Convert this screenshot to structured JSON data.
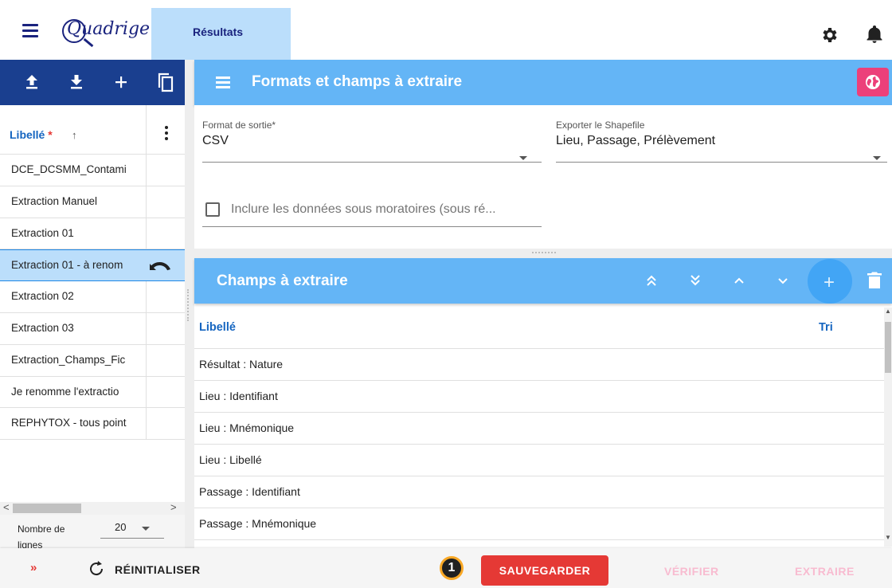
{
  "app": {
    "logo_text": "Quadrige"
  },
  "top_tabs": [
    {
      "label": "Résultats"
    }
  ],
  "left_panel": {
    "column_label": "Libellé",
    "required_mark": "*",
    "sort_arrow": "↑",
    "items": [
      "DCE_DCSMM_Contami",
      "Extraction Manuel",
      "Extraction 01",
      "Extraction 01 - à renom",
      "Extraction 02",
      "Extraction 03",
      "Extraction_Champs_Fic",
      "Je renomme l'extractio",
      "REPHYTOX - tous point"
    ],
    "selected_index": 3,
    "pager_label": "Nombre de lignes",
    "pager_value": "20"
  },
  "formats_panel": {
    "title": "Formats et champs à extraire",
    "format_label": "Format de sortie*",
    "format_value": "CSV",
    "shapefile_label": "Exporter le Shapefile",
    "shapefile_value": "Lieu, Passage, Prélèvement",
    "checkbox_label": "Inclure les données sous moratoires (sous ré...",
    "checkbox_checked": false
  },
  "champs_panel": {
    "title": "Champs à extraire",
    "columns": {
      "libelle": "Libellé",
      "tri": "Tri"
    },
    "rows": [
      "Résultat : Nature",
      "Lieu : Identifiant",
      "Lieu : Mnémonique",
      "Lieu : Libellé",
      "Passage : Identifiant",
      "Passage : Mnémonique"
    ]
  },
  "bottom_bar": {
    "expand_label": "»",
    "reset_label": "RÉINITIALISER",
    "badge": "1",
    "save_label": "SAUVEGARDER",
    "verify_label": "VÉRIFIER",
    "extract_label": "EXTRAIRE"
  },
  "colors": {
    "primary_dark": "#1a3f8f",
    "header_blue": "#64b5f6",
    "tab_blue": "#bbdefb",
    "save_red": "#e53935",
    "globe_pink": "#ec407a",
    "disabled_pink": "#f8bbd0"
  }
}
